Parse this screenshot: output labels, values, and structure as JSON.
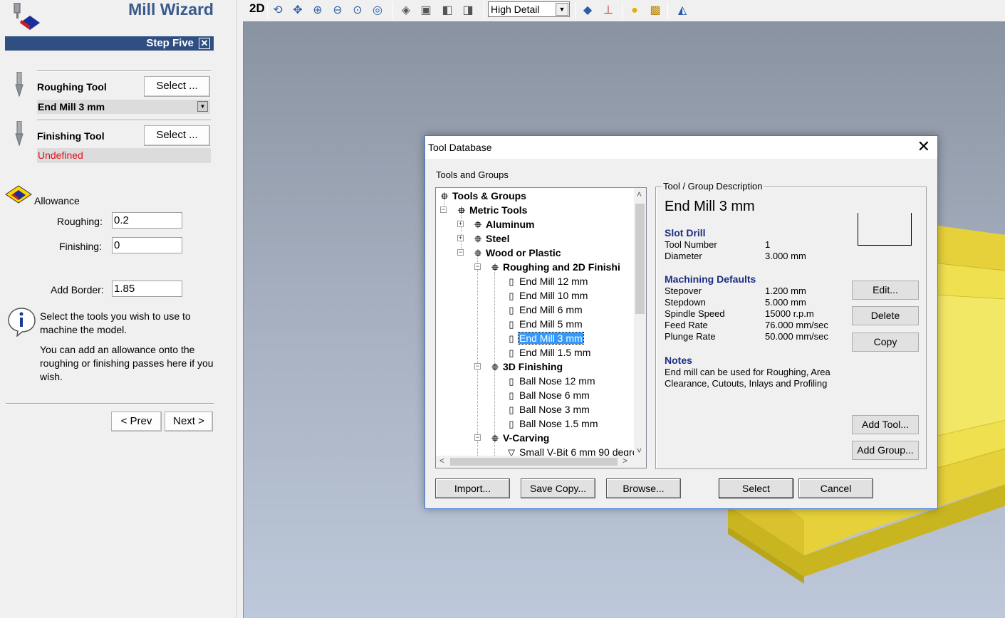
{
  "wizard": {
    "title": "Mill Wizard",
    "step": "Step Five",
    "roughing_label": "Roughing Tool",
    "roughing_select": "Select ...",
    "roughing_value": "End Mill 3 mm",
    "finishing_label": "Finishing Tool",
    "finishing_select": "Select ...",
    "finishing_value": "Undefined",
    "allowance_label": "Allowance",
    "roughing_allow_label": "Roughing:",
    "roughing_allow_value": "0.2",
    "finishing_allow_label": "Finishing:",
    "finishing_allow_value": "0",
    "border_label": "Add Border:",
    "border_value": "1.85",
    "help1": "Select the tools you wish to use to machine the model.",
    "help2": "You can add an allowance onto the roughing or finishing passes here if you wish.",
    "prev": "< Prev",
    "next": "Next >",
    "colors": {
      "header_bar": "#2f4f82",
      "undefined_text": "#e0101a"
    }
  },
  "toolbar": {
    "mode_2d": "2D",
    "detail": "High Detail",
    "icons": [
      "rotate-icon",
      "pan-icon",
      "zoom-in-icon",
      "zoom-out-icon",
      "zoom-window-icon",
      "zoom-all-icon",
      "iso-view-icon",
      "front-view-icon",
      "top-view-icon",
      "side-view-icon",
      "plane-icon",
      "axes-icon",
      "light-icon",
      "texture-icon",
      "render-icon"
    ]
  },
  "dialog": {
    "title": "Tool Database",
    "tree_caption": "Tools and Groups",
    "tree": [
      {
        "label": "Tools & Groups",
        "bold": true
      },
      {
        "label": "Metric Tools",
        "bold": true
      },
      {
        "label": "Aluminum",
        "bold": true
      },
      {
        "label": "Steel",
        "bold": true
      },
      {
        "label": "Wood or Plastic",
        "bold": true
      },
      {
        "label": "Roughing and 2D Finishi",
        "bold": true
      },
      {
        "label": "End Mill 12 mm"
      },
      {
        "label": "End Mill 10 mm"
      },
      {
        "label": "End Mill 6 mm"
      },
      {
        "label": "End Mill 5 mm"
      },
      {
        "label": "End Mill 3 mm",
        "selected": true
      },
      {
        "label": "End Mill 1.5 mm"
      },
      {
        "label": "3D Finishing",
        "bold": true
      },
      {
        "label": "Ball Nose 12 mm"
      },
      {
        "label": "Ball Nose 6 mm"
      },
      {
        "label": "Ball Nose 3 mm"
      },
      {
        "label": "Ball Nose 1.5 mm"
      },
      {
        "label": "V-Carving",
        "bold": true
      },
      {
        "label": "Small V-Bit 6 mm 90 degre"
      }
    ],
    "desc_caption": "Tool / Group Description",
    "tool_name": "End Mill 3 mm",
    "tool_type": "Slot Drill",
    "tool_number_label": "Tool Number",
    "tool_number": "1",
    "diameter_label": "Diameter",
    "diameter": "3.000 mm",
    "machining_heading": "Machining Defaults",
    "stepover_label": "Stepover",
    "stepover": "1.200 mm",
    "stepdown_label": "Stepdown",
    "stepdown": "5.000 mm",
    "spindle_label": "Spindle Speed",
    "spindle": "15000 r.p.m",
    "feed_label": "Feed Rate",
    "feed": "76.000 mm/sec",
    "plunge_label": "Plunge Rate",
    "plunge": "50.000 mm/sec",
    "notes_heading": "Notes",
    "notes": "End mill can be used for Roughing, Area Clearance, Cutouts, Inlays and Profiling",
    "btn_edit": "Edit...",
    "btn_delete": "Delete",
    "btn_copy": "Copy",
    "btn_add_tool": "Add Tool...",
    "btn_add_group": "Add Group...",
    "btn_import": "Import...",
    "btn_save_copy": "Save Copy...",
    "btn_browse": "Browse...",
    "btn_select": "Select",
    "btn_cancel": "Cancel"
  }
}
